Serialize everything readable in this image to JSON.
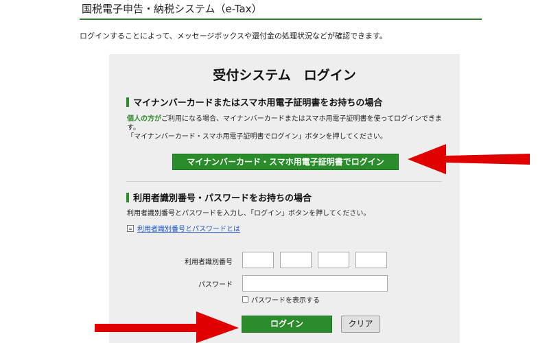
{
  "header": {
    "title": "国税電子申告・納税システム（e-Tax）"
  },
  "intro_text": "ログインすることによって、メッセージボックスや還付金の処理状況などが確認できます。",
  "panel": {
    "title": "受付システム　ログイン",
    "mynumber_section": {
      "heading": "マイナンバーカードまたはスマホ用電子証明書をお持ちの場合",
      "highlight": "個人の方が",
      "desc_line1": "ご利用になる場合、マイナンバーカードまたはスマホ用電子証明書を使ってログインできます。",
      "desc_line2": "「マイナンバーカード・スマホ用電子証明書でログイン」ボタンを押してください。",
      "button_label": "マイナンバーカード・スマホ用電子証明書でログイン"
    },
    "id_section": {
      "heading": "利用者識別番号・パスワードをお持ちの場合",
      "desc": "利用者識別番号とパスワードを入力し、「ログイン」ボタンを押してください。",
      "help_link": "利用者識別番号とパスワードとは",
      "id_label": "利用者識別番号",
      "id_values": [
        "",
        "",
        "",
        ""
      ],
      "password_label": "パスワード",
      "password_value": "",
      "show_password_label": "パスワードを表示する",
      "login_button": "ログイン",
      "clear_button": "クリア"
    }
  },
  "colors": {
    "brand_green": "#2a8c2a",
    "panel_bg": "#eeeeee",
    "annotation_arrow": "#e00000"
  }
}
